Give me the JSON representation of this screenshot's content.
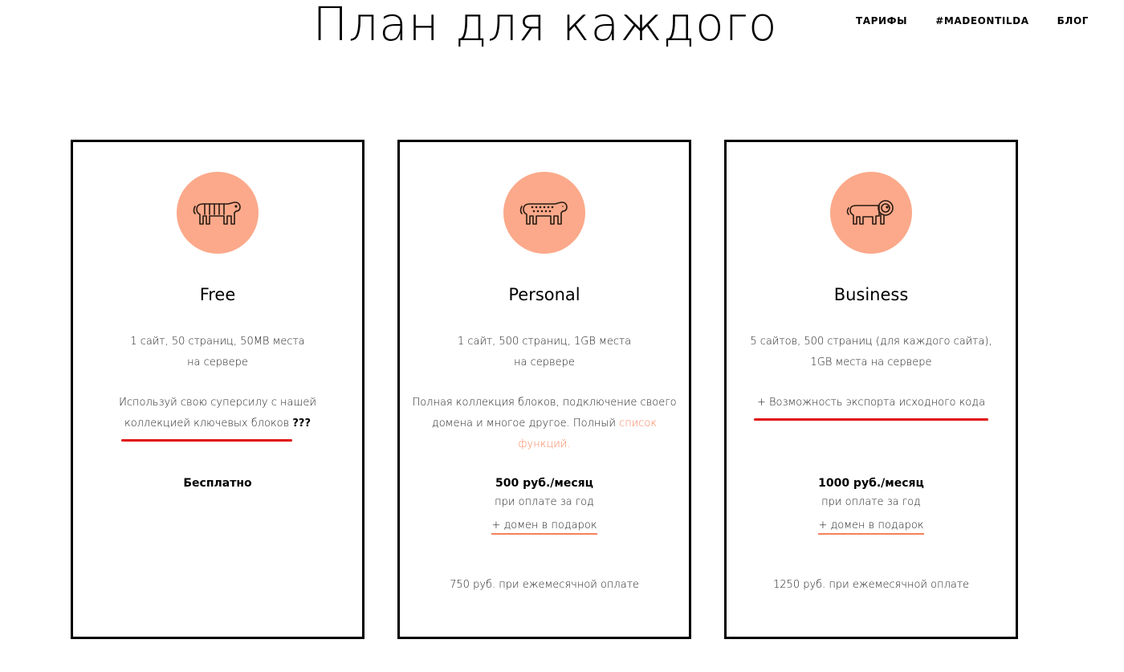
{
  "header": {
    "title": "План для каждого",
    "nav": [
      "ТАРИФЫ",
      "#MADEONTILDA",
      "БЛОГ"
    ]
  },
  "colors": {
    "accent": "#f5835c",
    "icon_bg": "#fba98a",
    "marker": "#e01010"
  },
  "plans": [
    {
      "icon": "tiger-icon",
      "name": "Free",
      "desc1_line1": "1 сайт, 50 страниц, 50MB места",
      "desc1_line2": "на сервере",
      "desc2_line1": "Используй свою суперсилу с нашей",
      "desc2_line2": "коллекцией ключевых блоков",
      "desc2_suffix": "???",
      "price": "Бесплатно"
    },
    {
      "icon": "leopard-icon",
      "name": "Personal",
      "desc1_line1": "1 сайт, 500 страниц, 1GB места",
      "desc1_line2": "на сервере",
      "desc2_line1": "Полная коллекция блоков, подключение своего",
      "desc2_line2_a": "домена и многое другое. Полный",
      "desc2_link_a": "список",
      "desc2_link_b": "функций",
      "desc2_end": ".",
      "price": "500 руб./месяц",
      "price_sub": "при оплате за год",
      "gift": "+ домен в подарок",
      "monthly": "750 руб. при ежемесячной оплате"
    },
    {
      "icon": "lion-icon",
      "name": "Business",
      "desc1_line1": "5 сайтов, 500 страниц (для каждого сайта),",
      "desc1_line2": "1GB места на сервере",
      "desc2_line1": "+ Возможность экспорта исходного кода",
      "price": "1000 руб./месяц",
      "price_sub": "при оплате за год",
      "gift": "+ домен в подарок",
      "monthly": "1250 руб. при ежемесячной оплате"
    }
  ]
}
